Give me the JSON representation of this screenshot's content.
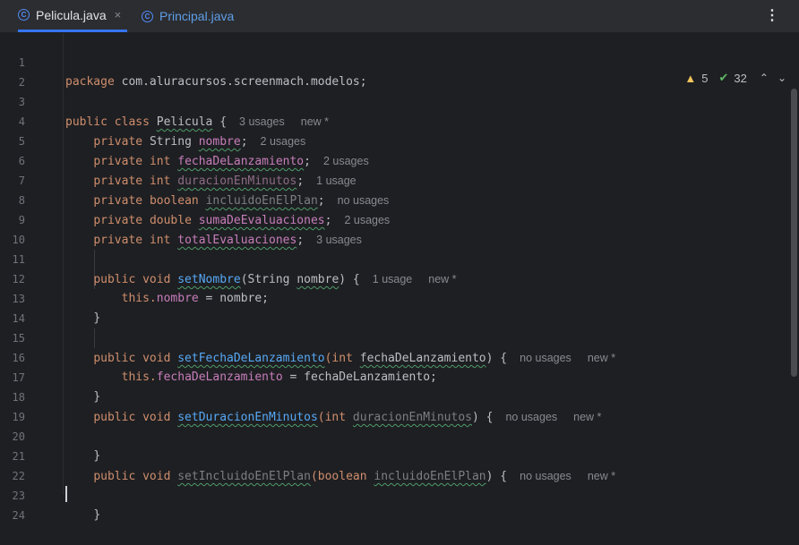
{
  "tabs": [
    {
      "label": "Pelicula.java",
      "icon": "class-icon",
      "active": true
    },
    {
      "label": "Principal.java",
      "icon": "run-class-icon",
      "active": false
    }
  ],
  "tab_close": "×",
  "more_menu": "⋮",
  "inspections": {
    "warnings": "5",
    "ok": "32"
  },
  "lines": [
    {
      "n": "1"
    },
    {
      "n": "2"
    },
    {
      "n": "3"
    },
    {
      "n": "4"
    },
    {
      "n": "5"
    },
    {
      "n": "6"
    },
    {
      "n": "7"
    },
    {
      "n": "8"
    },
    {
      "n": "9"
    },
    {
      "n": "10"
    },
    {
      "n": "11"
    },
    {
      "n": "12"
    },
    {
      "n": "13"
    },
    {
      "n": "14"
    },
    {
      "n": "15"
    },
    {
      "n": "16"
    },
    {
      "n": "17"
    },
    {
      "n": "18"
    },
    {
      "n": "19"
    },
    {
      "n": "20"
    },
    {
      "n": "21"
    },
    {
      "n": "22"
    },
    {
      "n": "23"
    },
    {
      "n": "24"
    }
  ],
  "code": {
    "package_kw": "package",
    "package_name": " com.aluracursos.screenmach.modelos;",
    "public_class": "public class ",
    "class_name": "Pelicula",
    "brace_open": " {",
    "usages_3": "3 usages",
    "usages_2": "2 usages",
    "usages_1": "1 usage",
    "no_usages": "no usages",
    "new_star": "new *",
    "private": "private ",
    "String": "String ",
    "int": "int ",
    "boolean": "boolean ",
    "double": "double ",
    "f_nombre": "nombre",
    "f_fecha": "fechaDeLanzamiento",
    "f_duracion": "duracionEnMinutos",
    "f_incluido": "incluidoEnElPlan",
    "f_suma": "sumaDeEvaluaciones",
    "f_total": "totalEvaluaciones",
    "semi": ";",
    "public_void": "public void ",
    "m_setNombre": "setNombre",
    "m_setFecha": "setFechaDeLanzamiento",
    "m_setDuracion": "setDuracionEnMinutos",
    "m_setIncluido": "setIncluidoEnElPlan",
    "p_string": "(String ",
    "p_int": "(int ",
    "p_boolean": "(boolean ",
    "close_paren_brace": ") {",
    "this_dot": "this.",
    "assign_nombre": " = nombre;",
    "assign_fecha": " = fechaDeLanzamiento;",
    "brace_close": "}"
  }
}
